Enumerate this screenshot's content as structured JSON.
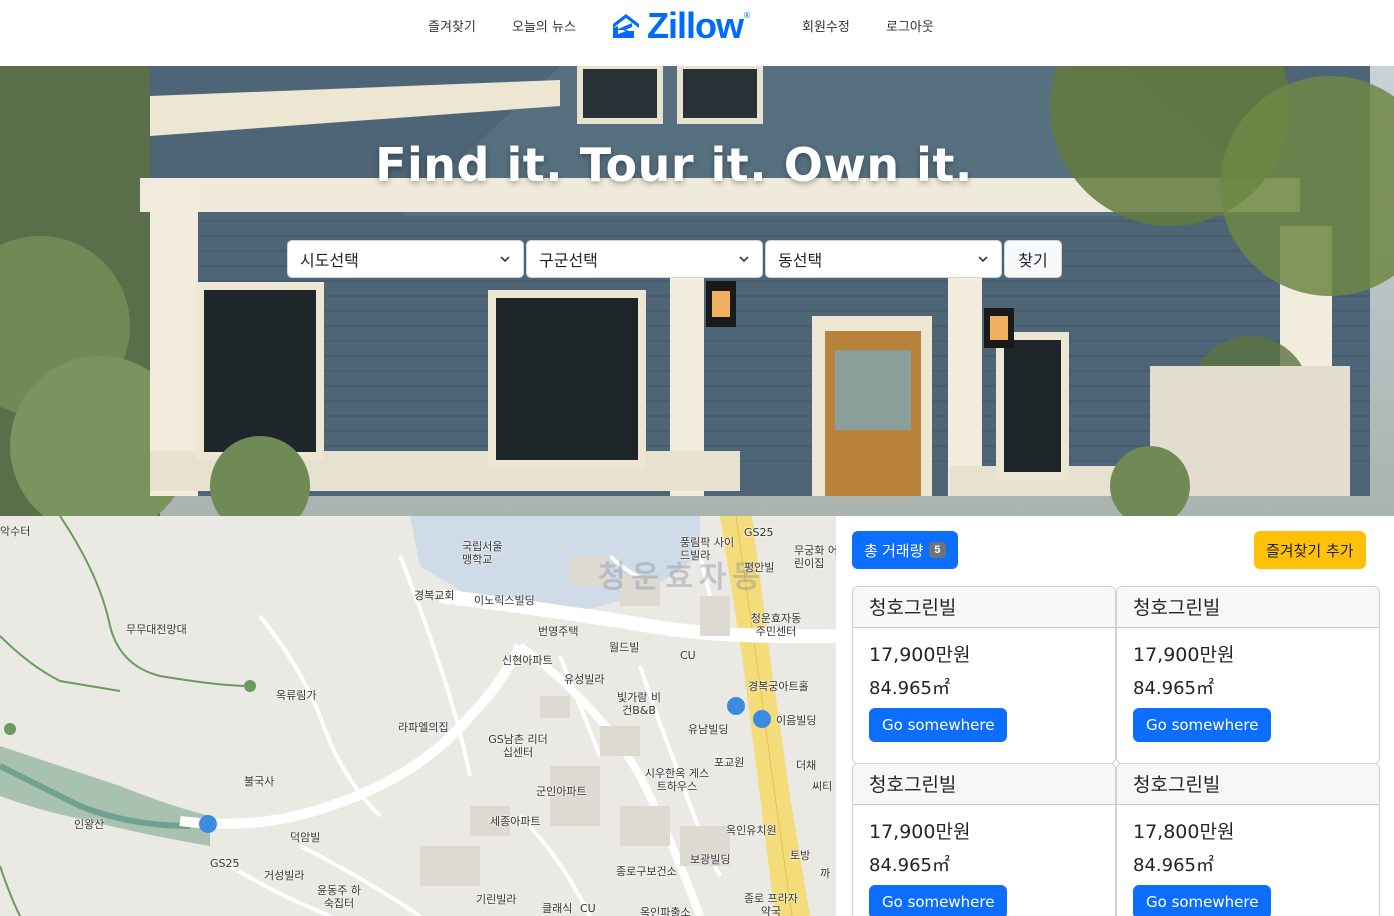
{
  "nav": {
    "favorites": "즐겨찾기",
    "news": "오늘의 뉴스",
    "logo": "Zillow",
    "logo_reg": "®",
    "profile": "회원수정",
    "logout": "로그아웃"
  },
  "hero": {
    "title": "Find it. Tour it. Own it.",
    "select_city": "시도선택",
    "select_district": "구군선택",
    "select_dong": "동선택",
    "find_button": "찾기"
  },
  "map": {
    "district_watermark": "청운효자동",
    "labels": [
      "악수터",
      "국립서울 맹학교",
      "풍림팍 사이드빌라",
      "GS25",
      "무궁화 어린이집",
      "평안빌",
      "경복교회",
      "이노릭스빌딩",
      "청운효자동 주민센터",
      "번영주택",
      "월드빌",
      "CU",
      "무무대전망대",
      "신현아파트",
      "유성빌라",
      "경복궁아트홀",
      "빛가람 비건B&B",
      "옥류림가",
      "라파엘의집",
      "GS남촌 리더십센터",
      "유남빌딩",
      "이음빌딩",
      "포교원",
      "더채",
      "불국사",
      "시우한옥 게스트하우스",
      "군인아파트",
      "씨티",
      "인왕산",
      "세종아파트",
      "옥인유치원",
      "덕암빌",
      "GS25",
      "토방",
      "종로구보건소",
      "보광빌딩",
      "거성빌라",
      "윤동주 하숙집터",
      "기린빌라",
      "클래식",
      "CU",
      "옥인파출소",
      "종로 프라자약국",
      "까"
    ]
  },
  "panel": {
    "total_label": "총 거래량",
    "total_count": "5",
    "fav_add": "즐겨찾기 추가",
    "cards": [
      {
        "name": "청호그린빌",
        "price": "17,900만원",
        "area": "84.965㎡",
        "button": "Go somewhere"
      },
      {
        "name": "청호그린빌",
        "price": "17,900만원",
        "area": "84.965㎡",
        "button": "Go somewhere"
      },
      {
        "name": "청호그린빌",
        "price": "17,900만원",
        "area": "84.965㎡",
        "button": "Go somewhere"
      },
      {
        "name": "청호그린빌",
        "price": "17,800만원",
        "area": "84.965㎡",
        "button": "Go somewhere"
      }
    ]
  },
  "colors": {
    "brand": "#006AFF",
    "primary": "#0d6efd",
    "warning": "#ffc107",
    "badge": "#6c757d"
  }
}
